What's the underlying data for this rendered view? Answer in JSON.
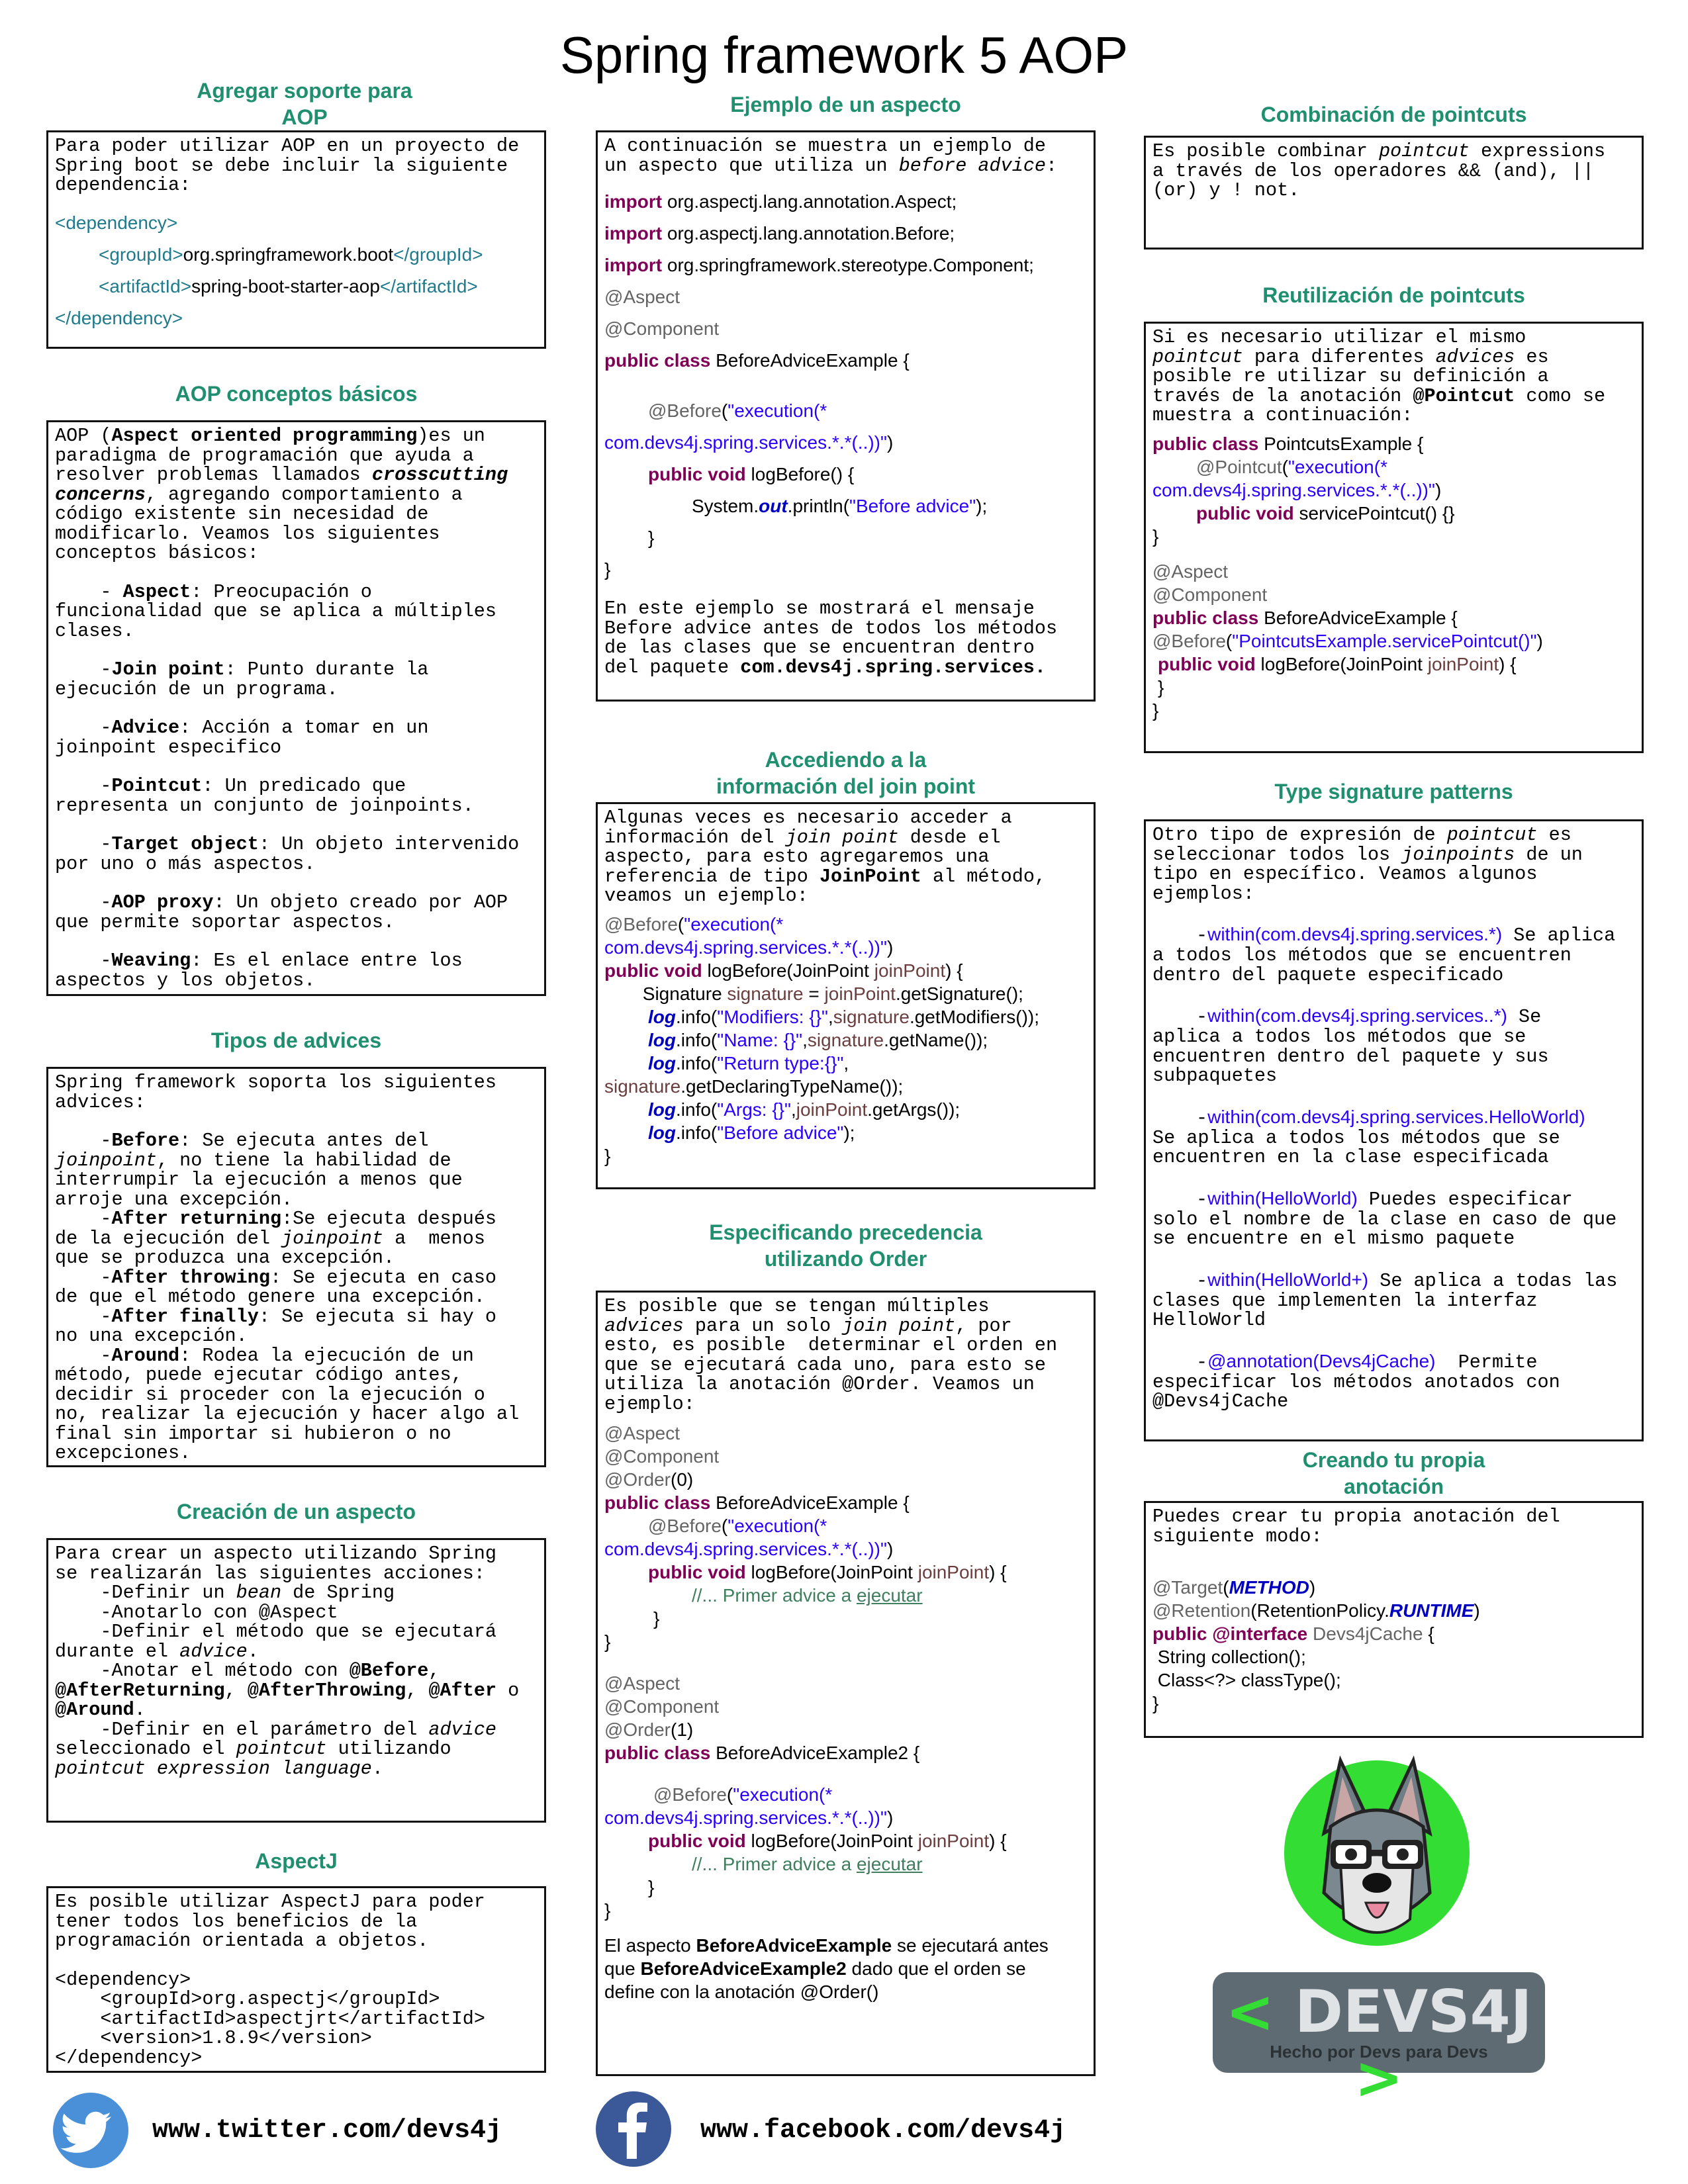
{
  "title": "Spring framework 5 AOP",
  "colors": {
    "section_title": "#1f8f6f",
    "keyword": "#7f0055",
    "annotation": "#646464",
    "string": "#2a00ff",
    "parameter": "#6a3e3e",
    "comment": "#3f7f5f",
    "twitter": "#4a90d9",
    "facebook": "#3b5998",
    "logo_bg": "#5f6b72",
    "logo_accent": "#33dd33"
  },
  "sections": {
    "soporte": {
      "title": "Agregar soporte para\nAOP",
      "intro": [
        "Para poder utilizar AOP en un proyecto de",
        "Spring boot se debe incluir la siguiente",
        "dependencia:"
      ],
      "code": {
        "dep_open": "<dependency>",
        "group_open": "<groupId>",
        "group_val": "org.springframework.boot",
        "group_close": "</groupId>",
        "artifact_open": "<artifactId>",
        "artifact_val": "spring-boot-starter-aop",
        "artifact_close": "</artifactId>",
        "dep_close": "</dependency>"
      }
    },
    "conceptos": {
      "title": "AOP conceptos básicos",
      "p1_a": "AOP (",
      "p1_b": "Aspect oriented programming",
      "p1_c": ")es un",
      "p2": "paradigma de programación que ayuda a",
      "p3_a": "resolver problemas llamados ",
      "p3_b": "crosscutting",
      "p4_a": "concerns",
      "p4_b": ", agregando comportamiento a",
      "p5": "código existente sin necesidad de",
      "p6": "modificarlo. Veamos los siguientes",
      "p7": "conceptos básicos:",
      "items": [
        {
          "pre": "    - ",
          "term": "Aspect",
          "l1": ": Preocupación o",
          "l2": "funcionalidad que se aplica a múltiples",
          "l3": "clases."
        },
        {
          "pre": "    -",
          "term": "Join point",
          "l1": ": Punto durante la",
          "l2": "ejecución de un programa.",
          "l3": ""
        },
        {
          "pre": "    -",
          "term": "Advice",
          "l1": ": Acción a tomar en un",
          "l2": "joinpoint especifico",
          "l3": ""
        },
        {
          "pre": "    -",
          "term": "Pointcut",
          "l1": ": Un predicado que",
          "l2": "representa un conjunto de joinpoints.",
          "l3": ""
        },
        {
          "pre": "    -",
          "term": "Target object",
          "l1": ": Un objeto intervenido",
          "l2": "por uno o más aspectos.",
          "l3": ""
        },
        {
          "pre": "    -",
          "term": "AOP proxy",
          "l1": ": Un objeto creado por AOP",
          "l2": "que permite soportar aspectos.",
          "l3": ""
        },
        {
          "pre": "    -",
          "term": "Weaving",
          "l1": ": Es el enlace entre los",
          "l2": "aspectos y los objetos.",
          "l3": ""
        }
      ]
    },
    "tipos": {
      "title": "Tipos de advices",
      "intro": [
        "Spring framework soporta los siguientes",
        "advices:"
      ],
      "before": {
        "pre": "    -",
        "term": "Before",
        "l1": ": Se ejecuta antes del",
        "l2a": "joinpoint",
        "l2b": ", no tiene la habilidad de",
        "l3": "interrumpir la ejecución a menos que",
        "l4": "arroje una excepción."
      },
      "after_returning": {
        "pre": "    -",
        "term": "After returning",
        "l1": ":Se ejecuta después",
        "l2a": "de la ejecución del ",
        "l2b": "joinpoint",
        "l2c": " a  menos",
        "l3": "que se produzca una excepción."
      },
      "after_throwing": {
        "pre": "    -",
        "term": "After throwing",
        "l1": ": Se ejecuta en caso",
        "l2": "de que el método genere una excepción."
      },
      "after_finally": {
        "pre": "    -",
        "term": "After finally",
        "l1": ": Se ejecuta si hay o",
        "l2": "no una excepción."
      },
      "around": {
        "pre": "    -",
        "term": "Around",
        "l1": ": Rodea la ejecución de un",
        "l2": "método, puede ejecutar código antes,",
        "l3": "decidir si proceder con la ejecución o",
        "l4": "no, realizar la ejecución y hacer algo al",
        "l5": "final sin importar si hubieron o no",
        "l6": "excepciones."
      }
    },
    "creacion": {
      "title": "Creación de un aspecto",
      "l1": "Para crear un aspecto utilizando Spring",
      "l2": "se realizarán las siguientes acciones:",
      "l3a": "    -Definir un ",
      "l3b": "bean",
      "l3c": " de Spring",
      "l4": "    -Anotarlo con @Aspect",
      "l5": "    -Definir el método que se ejecutará",
      "l6a": "durante el ",
      "l6b": "advice",
      "l6c": ".",
      "l7a": "    -Anotar el método con ",
      "l7b": "@Before",
      "l7c": ",",
      "l8a": "@AfterReturning",
      "l8b": ", ",
      "l8c": "@AfterThrowing",
      "l8d": ", ",
      "l8e": "@After",
      "l8f": " o",
      "l9a": "@Around",
      "l9b": ".",
      "l10a": "    -Definir en el parámetro del ",
      "l10b": "advice",
      "l11a": "seleccionado el ",
      "l11b": "pointcut",
      "l11c": " utilizando",
      "l12a": "pointcut expression language",
      "l12b": "."
    },
    "aspectj": {
      "title": "AspectJ",
      "lines": [
        "Es posible utilizar AspectJ para poder",
        "tener todos los beneficios de la",
        "programación orientada a objetos.",
        "",
        "<dependency>",
        "    <groupId>org.aspectj</groupId>",
        "    <artifactId>aspectjrt</artifactId>",
        "    <version>1.8.9</version>",
        "</dependency>"
      ]
    },
    "ejemplo": {
      "title": "Ejemplo de un aspecto",
      "intro1": "A continuación se muestra un ejemplo de",
      "intro2a": "un aspecto que utiliza un ",
      "intro2b": "before advice",
      "intro2c": ":",
      "import_kw": "import",
      "imports": [
        " org.aspectj.lang.annotation.Aspect;",
        " org.aspectj.lang.annotation.Before;",
        " org.springframework.stereotype.Component;"
      ],
      "ann_aspect": "@Aspect",
      "ann_component": "@Component",
      "public_class": "public class",
      "class_name": " BeforeAdviceExample {",
      "ann_before": "@Before",
      "before_open": "(",
      "before_str1": "\"execution(*",
      "before_str2": "com.devs4j.spring.services.*.*(..))\"",
      "before_close": ")",
      "public_void": "public void",
      "method": " logBefore() {",
      "sys_a": "System.",
      "sys_out": "out",
      "sys_b": ".println(",
      "sys_str": "\"Before advice\"",
      "sys_c": ");",
      "close1": "}",
      "close2": "}",
      "outro1": "En este ejemplo se mostrará el mensaje",
      "outro2": "Before advice antes de todos los métodos",
      "outro3": "de las clases que se encuentran dentro",
      "outro4a": "del paquete ",
      "outro4b": "com.devs4j.spring.services."
    },
    "joinpoint": {
      "title": "Accediendo a la\ninformación del join point",
      "i1": "Algunas veces es necesario acceder a",
      "i2a": "información del ",
      "i2b": "join point",
      "i2c": " desde el",
      "i3": "aspecto, para esto agregaremos una",
      "i4a": "referencia de tipo ",
      "i4b": "JoinPoint",
      "i4c": " al método,",
      "i5": "veamos un ejemplo:",
      "ann_before": "@Before",
      "str1": "\"execution(*",
      "str2": "com.devs4j.spring.services.*.*(..))\"",
      "public_void": "public void",
      "m_a": " logBefore(JoinPoint ",
      "param": "joinPoint",
      "m_b": ") {",
      "sig_a": " Signature ",
      "sig_var": "signature",
      "sig_b": " = ",
      "sig_c": ".getSignature();",
      "log": "log",
      "info": ".info(",
      "s_mod": "\"Modifiers: {}\"",
      "mod_b": ".getModifiers());",
      "s_name": "\"Name: {}\"",
      "name_b": ".getName());",
      "s_ret": "\"Return type:{}\"",
      "ret_b": ".getDeclaringTypeName());",
      "s_args": "\"Args: {}\"",
      "args_b": ".getArgs());",
      "s_before": "\"Before advice\"",
      "end": ");",
      "comma": ",",
      "close": "}"
    },
    "precedencia": {
      "title": "Especificando precedencia\nutilizando Order",
      "i1": "Es posible que se tengan múltiples",
      "i2a": "advices",
      "i2b": " para un solo ",
      "i2c": "join point",
      "i2d": ", por",
      "i3": "esto, es posible  determinar el orden en",
      "i4": "que se ejecutará cada uno, para esto se",
      "i5": "utiliza la anotación @Order. Veamos un",
      "i6": "ejemplo:",
      "ann_aspect": "@Aspect",
      "ann_component": "@Component",
      "ann_order": "@Order",
      "order0": "(0)",
      "order1": "(1)",
      "public_class": "public class",
      "class1": " BeforeAdviceExample {",
      "class2": " BeforeAdviceExample2 {",
      "ann_before": "@Before",
      "str1": "\"execution(*",
      "str2": "com.devs4j.spring.services.*.*(..))\"",
      "public_void": "public void",
      "m_a": " logBefore(JoinPoint ",
      "param": "joinPoint",
      "m_b": ") {",
      "comment": "//... Primer advice a ",
      "comment_u": "ejecutar",
      "close": "}",
      "o1a": "El aspecto ",
      "o1b": "BeforeAdviceExample",
      "o1c": " se ejecutará antes",
      "o2a": "que ",
      "o2b": "BeforeAdviceExample2",
      "o2c": " dado que el orden se",
      "o3": "define con la anotación @Order()"
    },
    "combinacion": {
      "title": "Combinación de pointcuts",
      "l1a": "Es posible combinar ",
      "l1b": "pointcut",
      "l1c": " expressions",
      "l2": "a través de los operadores && (and), ||",
      "l3": "(or) y ! not."
    },
    "reutilizacion": {
      "title": "Reutilización de pointcuts",
      "l1": "Si es necesario utilizar el mismo",
      "l2a": "pointcut",
      "l2b": " para diferentes ",
      "l2c": "advices",
      "l2d": " es",
      "l3": "posible re utilizar su definición a",
      "l4a": "través de la anotación ",
      "l4b": "@Pointcut",
      "l4c": " como se",
      "l5": "muestra a continuación:",
      "public_class": "public class",
      "class1": " PointcutsExample {",
      "ann_pointcut": "@Pointcut",
      "str1": "\"execution(*",
      "str2": "com.devs4j.spring.services.*.*(..))\"",
      "public_void": "public void",
      "m1": " servicePointcut() {}",
      "close": "}",
      "ann_aspect": "@Aspect",
      "ann_component": "@Component",
      "class2": " BeforeAdviceExample {",
      "ann_before": "@Before",
      "before_str": "\"PointcutsExample.servicePointcut()\"",
      "m2a": " logBefore(JoinPoint ",
      "param": "joinPoint",
      "m2b": ") {"
    },
    "type_sig": {
      "title": "Type signature patterns",
      "i1a": "Otro tipo de expresión de ",
      "i1b": "pointcut",
      "i1c": " es",
      "i2a": "seleccionar todos los ",
      "i2b": "joinpoints",
      "i2c": " de un",
      "i3": "tipo en específico. Veamos algunos",
      "i4": "ejemplos:",
      "e1_expr": "within(com.devs4j.spring.services.*)",
      "e1_a": " Se aplica",
      "e1_b": "a todos los métodos que se encuentren",
      "e1_c": "dentro del paquete especificado",
      "e2_expr": "within(com.devs4j.spring.services..*)",
      "e2_a": " Se",
      "e2_b": "aplica a todos los métodos que se",
      "e2_c": "encuentren dentro del paquete y sus",
      "e2_d": "subpaquetes",
      "e3_expr": "within(com.devs4j.spring.services.HelloWorld)",
      "e3_b": "Se aplica a todos los métodos que se",
      "e3_c": "encuentren en la clase especificada",
      "e4_expr": "within(HelloWorld)",
      "e4_a": " Puedes especificar",
      "e4_b": "solo el nombre de la clase en caso de que",
      "e4_c": "se encuentre en el mismo paquete",
      "e5_expr": "within(HelloWorld+)",
      "e5_a": " Se aplica a todas las",
      "e5_b": "clases que implementen la interfaz",
      "e5_c": "HelloWorld",
      "e6_expr": "@annotation(Devs4jCache)",
      "e6_a": "  Permite",
      "e6_b": "especificar los métodos anotados con",
      "e6_c": "@Devs4jCache",
      "dash": "-"
    },
    "anotacion": {
      "title": "Creando tu propia\nanotación",
      "l1": "Puedes crear tu propia anotación del",
      "l2": "siguiente modo:",
      "target": "@Target",
      "method_const": "METHOD",
      "retention": "@Retention",
      "ret_a": "(RetentionPolicy.",
      "runtime": "RUNTIME",
      "open": "(",
      "close_paren": ")",
      "public_interface": "public @interface",
      "iface": " Devs4jCache",
      "brace": " {",
      "m1": " String collection();",
      "m2": " Class<?> classType();",
      "close": "}"
    }
  },
  "logo": {
    "brand": "DEVS4J",
    "left_bracket": "<",
    "right_bracket": ">",
    "tagline": "Hecho por Devs para Devs"
  },
  "footer": {
    "twitter": "www.twitter.com/devs4j",
    "facebook": "www.facebook.com/devs4j",
    "twitter_icon": "twitter-bird-icon",
    "facebook_icon": "facebook-f-icon"
  }
}
